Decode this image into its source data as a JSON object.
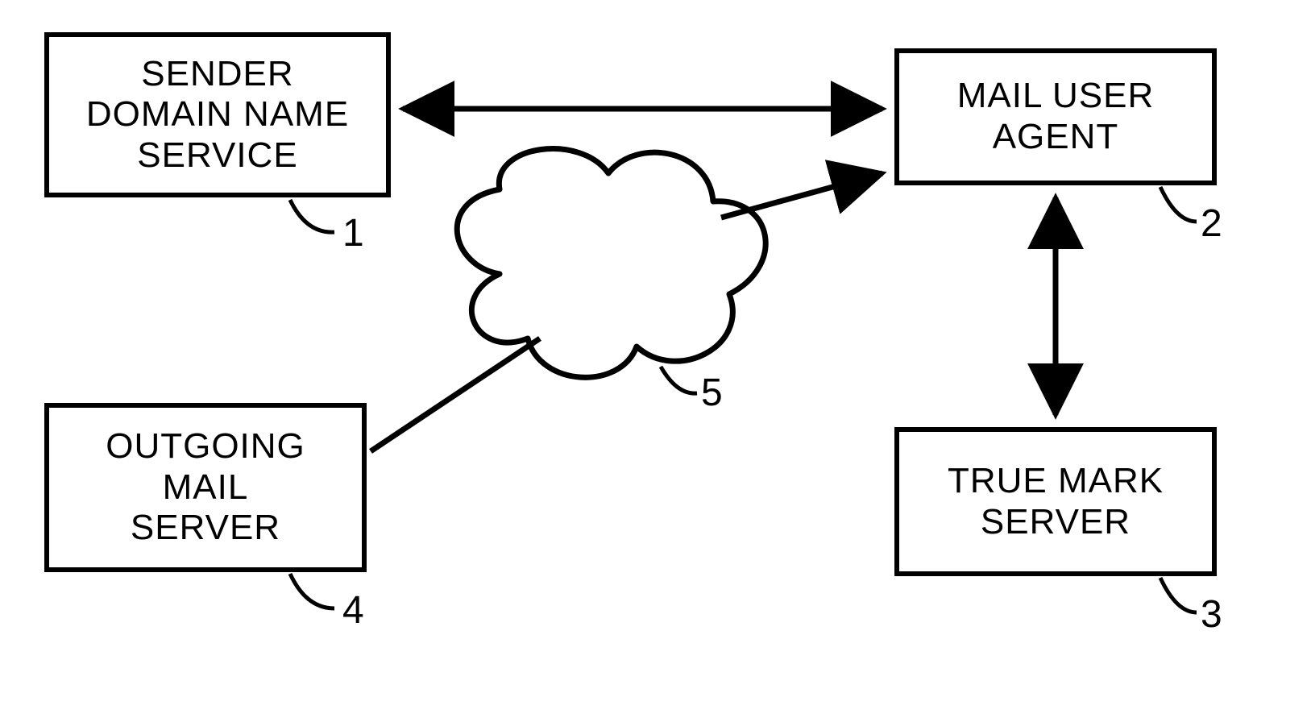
{
  "diagram": {
    "nodes": {
      "sender_dns": {
        "label": "SENDER\nDOMAIN NAME\nSERVICE",
        "ref": "1"
      },
      "mua": {
        "label": "MAIL USER\nAGENT",
        "ref": "2"
      },
      "truemark": {
        "label": "TRUE MARK\nSERVER",
        "ref": "3"
      },
      "outgoing": {
        "label": "OUTGOING\nMAIL\nSERVER",
        "ref": "4"
      },
      "cloud": {
        "ref": "5"
      }
    },
    "edges": [
      {
        "from": "sender_dns",
        "to": "mua",
        "bidir": true
      },
      {
        "from": "mua",
        "to": "truemark",
        "bidir": true
      },
      {
        "from": "outgoing",
        "to": "cloud",
        "bidir": false
      },
      {
        "from": "cloud",
        "to": "mua",
        "bidir": false,
        "arrow_only_at": "mua"
      }
    ]
  }
}
